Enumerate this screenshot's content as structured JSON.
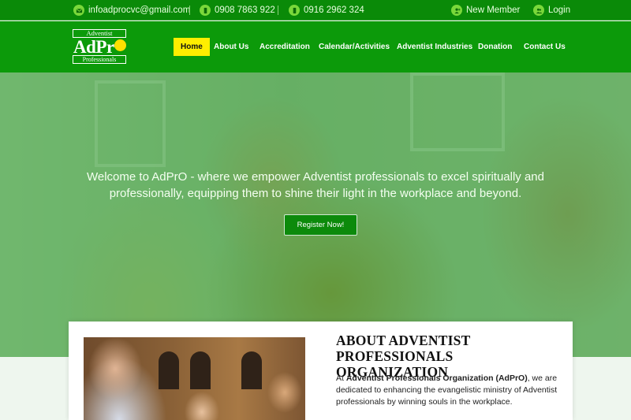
{
  "topbar": {
    "email": "infoadprocvc@gmail.com",
    "phone1": "0908 7863 922",
    "phone2": "0916 2962 324",
    "new_member": "New Member",
    "login": "Login"
  },
  "logo": {
    "top_text": "Adventist",
    "main_text": "AdPr",
    "bottom_text": "Professionals"
  },
  "nav": {
    "items": [
      "Home",
      "About Us",
      "Accreditation",
      "Calendar/Activities",
      "Adventist Industries",
      "Donation",
      "Contact Us"
    ],
    "active": "Home"
  },
  "hero": {
    "tagline": "Welcome to AdPrO - where we empower Adventist professionals to excel spiritually and professionally, equipping them to shine their light in the workplace and beyond.",
    "cta": "Register Now!"
  },
  "about": {
    "title": "ABOUT ADVENTIST PROFESSIONALS ORGANIZATION",
    "intro_prefix": "At ",
    "org_name": "Adventist Professionals Organization (AdPrO)",
    "intro_suffix": ", we are dedicated to enhancing the evangelistic ministry of Adventist professionals by winning souls in the workplace."
  },
  "colors": {
    "brand_green": "#0c9a0a",
    "topbar_green": "#0a8a08",
    "active_yellow": "#ffee00",
    "icon_green": "#7ad83a"
  }
}
